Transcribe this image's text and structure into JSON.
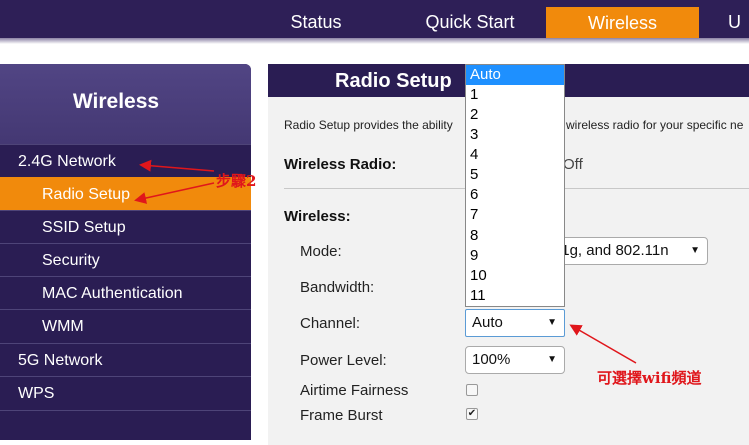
{
  "topnav": {
    "tabs": [
      {
        "label": "Status"
      },
      {
        "label": "Quick Start"
      },
      {
        "label": "Wireless",
        "active": true
      },
      {
        "label": "U"
      }
    ]
  },
  "sidebar": {
    "title": "Wireless",
    "items": [
      {
        "label": "2.4G Network",
        "level": 1
      },
      {
        "label": "Radio Setup",
        "level": 2,
        "active": true
      },
      {
        "label": "SSID Setup",
        "level": 2
      },
      {
        "label": "Security",
        "level": 2
      },
      {
        "label": "MAC Authentication",
        "level": 2
      },
      {
        "label": "WMM",
        "level": 2
      },
      {
        "label": "5G Network",
        "level": 1
      },
      {
        "label": "WPS",
        "level": 1
      }
    ]
  },
  "main": {
    "title": "Radio Setup",
    "description_left": "Radio Setup provides the ability",
    "description_right": "wireless radio for your specific ne",
    "wireless_radio_label": "Wireless Radio:",
    "wireless_radio_value": "Off",
    "wireless_section_label": "Wireless:",
    "mode_label": "Mode:",
    "mode_value": "11g, and 802.11n",
    "bandwidth_label": "Bandwidth:",
    "channel_label": "Channel:",
    "channel_value": "Auto",
    "power_level_label": "Power Level:",
    "power_level_value": "100%",
    "airtime_fairness_label": "Airtime Fairness",
    "airtime_fairness_checked": false,
    "frame_burst_label": "Frame Burst",
    "frame_burst_checked": true
  },
  "channel_dropdown": {
    "options": [
      "Auto",
      "1",
      "2",
      "3",
      "4",
      "5",
      "6",
      "7",
      "8",
      "9",
      "10",
      "11"
    ],
    "selected": "Auto"
  },
  "annotations": {
    "step2": "步驟2",
    "channel_note": "可選擇wifi頻道"
  },
  "colors": {
    "nav_bg": "#2e1f57",
    "active_orange": "#f18a0c",
    "sidebar_bg": "#2a1d53",
    "annotation_red": "#e0161b",
    "dropdown_highlight": "#1e90ff"
  },
  "icons": {
    "dropdown_arrow": "▼",
    "checkmark": "✔"
  }
}
